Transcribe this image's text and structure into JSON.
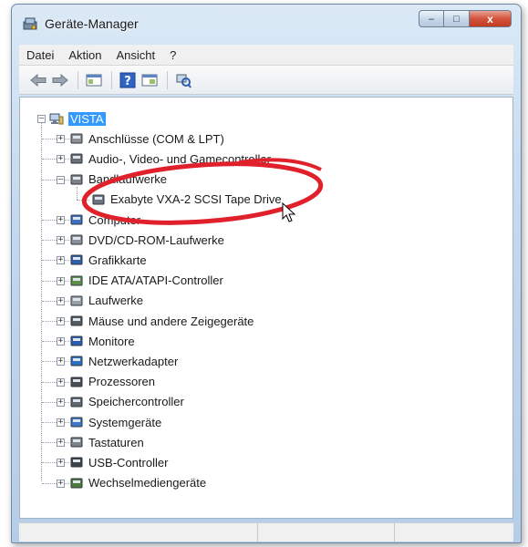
{
  "window": {
    "title": "Geräte-Manager"
  },
  "caption_buttons": {
    "minimize": "–",
    "maximize": "□",
    "close": "x"
  },
  "menu": [
    "Datei",
    "Aktion",
    "Ansicht",
    "?"
  ],
  "toolbar": [
    "back-arrow-icon",
    "forward-arrow-icon",
    "show-hide-tree-icon",
    "help-icon",
    "properties-icon",
    "scan-hardware-icon"
  ],
  "tree": {
    "root": "VISTA",
    "categories": [
      {
        "label": "Anschlüsse (COM & LPT)",
        "icon": "port-icon",
        "expanded": false
      },
      {
        "label": "Audio-, Video- und Gamecontroller",
        "icon": "speaker-icon",
        "expanded": false
      },
      {
        "label": "Bandlaufwerke",
        "icon": "tape-drive-icon",
        "expanded": true,
        "children": [
          "Exabyte VXA-2 SCSI Tape Drive"
        ]
      },
      {
        "label": "Computer",
        "icon": "computer-icon",
        "expanded": false
      },
      {
        "label": "DVD/CD-ROM-Laufwerke",
        "icon": "dvd-icon",
        "expanded": false
      },
      {
        "label": "Grafikkarte",
        "icon": "display-adapter-icon",
        "expanded": false
      },
      {
        "label": "IDE ATA/ATAPI-Controller",
        "icon": "ide-controller-icon",
        "expanded": false
      },
      {
        "label": "Laufwerke",
        "icon": "disk-drive-icon",
        "expanded": false
      },
      {
        "label": "Mäuse und andere Zeigegeräte",
        "icon": "mouse-icon",
        "expanded": false
      },
      {
        "label": "Monitore",
        "icon": "monitor-icon",
        "expanded": false
      },
      {
        "label": "Netzwerkadapter",
        "icon": "network-adapter-icon",
        "expanded": false
      },
      {
        "label": "Prozessoren",
        "icon": "processor-icon",
        "expanded": false
      },
      {
        "label": "Speichercontroller",
        "icon": "storage-controller-icon",
        "expanded": false
      },
      {
        "label": "Systemgeräte",
        "icon": "system-devices-icon",
        "expanded": false
      },
      {
        "label": "Tastaturen",
        "icon": "keyboard-icon",
        "expanded": false
      },
      {
        "label": "USB-Controller",
        "icon": "usb-icon",
        "expanded": false
      },
      {
        "label": "Wechselmediengeräte",
        "icon": "removable-media-icon",
        "expanded": false
      }
    ]
  },
  "annotation": {
    "type": "red-ellipse-highlight",
    "color": "#e0202a"
  },
  "colors": {
    "selection": "#3399ff",
    "title_gradient": "#c4d8ee",
    "close_button": "#d3533c"
  }
}
